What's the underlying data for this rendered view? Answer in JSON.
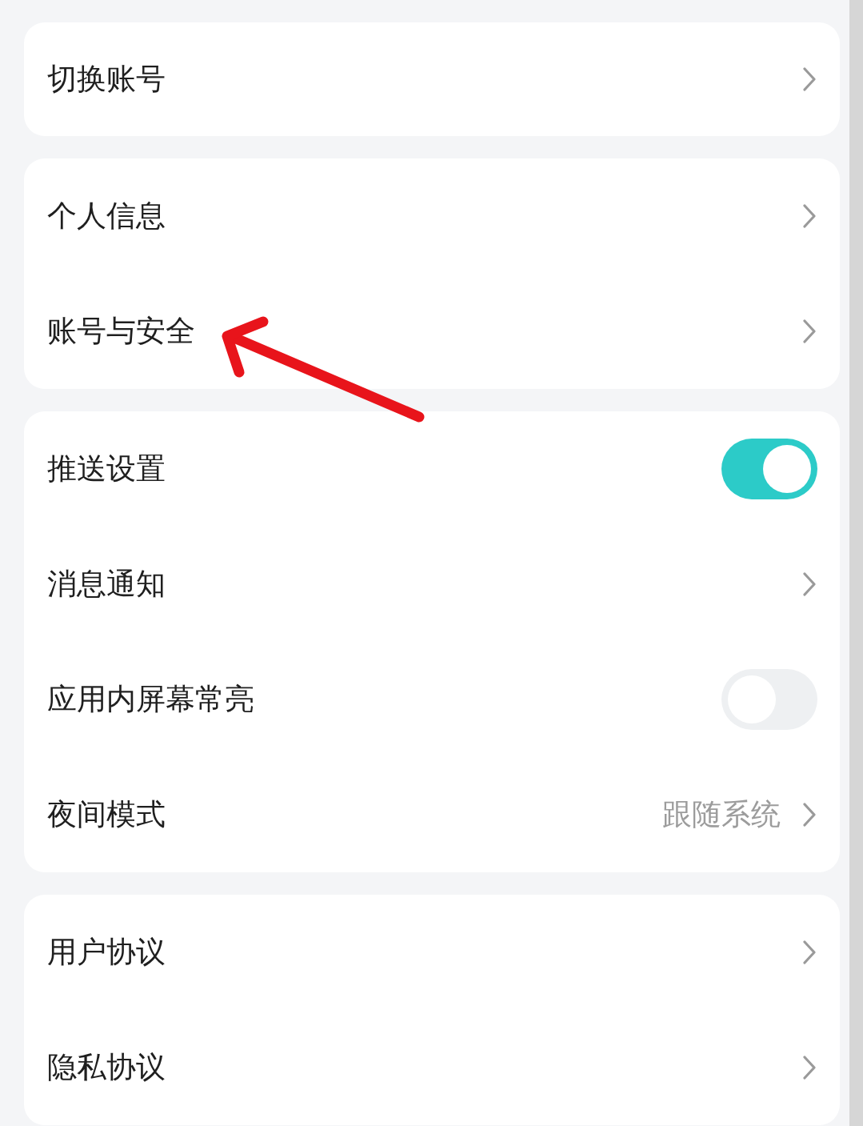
{
  "groups": [
    {
      "items": [
        {
          "kind": "link",
          "label": "切换账号"
        }
      ]
    },
    {
      "items": [
        {
          "kind": "link",
          "label": "个人信息"
        },
        {
          "kind": "link",
          "label": "账号与安全"
        }
      ]
    },
    {
      "items": [
        {
          "kind": "toggle",
          "label": "推送设置",
          "on": true
        },
        {
          "kind": "link",
          "label": "消息通知"
        },
        {
          "kind": "toggle",
          "label": "应用内屏幕常亮",
          "on": false
        },
        {
          "kind": "value",
          "label": "夜间模式",
          "value": "跟随系统"
        }
      ]
    },
    {
      "items": [
        {
          "kind": "link",
          "label": "用户协议"
        },
        {
          "kind": "link",
          "label": "隐私协议"
        }
      ]
    }
  ],
  "annotation": {
    "kind": "arrow"
  }
}
